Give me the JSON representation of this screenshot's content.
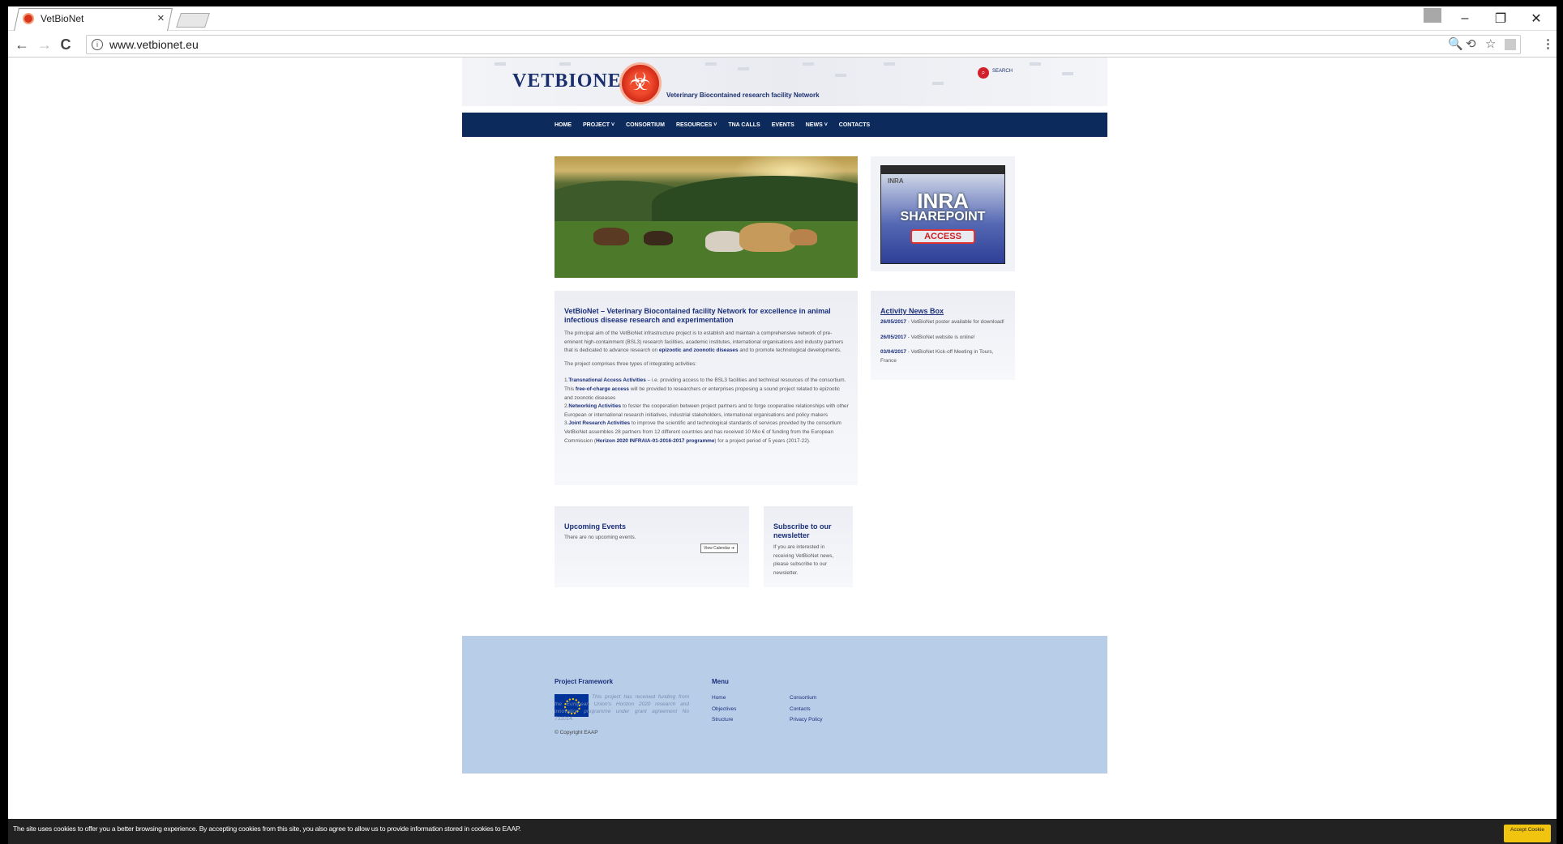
{
  "browser": {
    "tab_title": "VetBioNet",
    "tab_close": "×",
    "url": "www.vetbionet.eu",
    "info_icon": "i",
    "controls": {
      "minimize": "–",
      "restore": "❐",
      "close": "✕"
    },
    "nav": {
      "back": "←",
      "forward": "→",
      "reload": "C"
    },
    "right_icons": {
      "zoom": "🔍",
      "translate": "⟲",
      "bookmark": "☆",
      "menu": "⋮"
    }
  },
  "site": {
    "logo_text": "VETBIONET",
    "tagline": "Veterinary Biocontained research facility Network",
    "search_label": "SEARCH",
    "nav": [
      {
        "label": "HOME"
      },
      {
        "label": "PROJECT ˅"
      },
      {
        "label": "CONSORTIUM"
      },
      {
        "label": "RESOURCES ˅"
      },
      {
        "label": "TNA CALLS"
      },
      {
        "label": "EVENTS"
      },
      {
        "label": "NEWS ˅"
      },
      {
        "label": "CONTACTS"
      }
    ],
    "inra": {
      "logo": "INRA",
      "title": "INRA",
      "subtitle": "SHAREPOINT",
      "button": "ACCESS"
    },
    "intro": {
      "title": "VetBioNet – Veterinary Biocontained facility Network for excellence in animal infectious disease research and experimentation",
      "para1": "The principal aim of the VetBioNet infrastructure project is to establish and maintain a comprehensive network of pre-eminent high-containment (BSL3) research facilities, academic institutes, international organisations and industry partners that is dedicated to advance research on",
      "para1_bold": "epizootic and zoonotic diseases",
      "para1_end": "and to promote technological developments.",
      "para2": "The project comprises three types of integrating activities:",
      "item1_num": "1.",
      "item1_bold": "Transnational Access Activities",
      "item1_text": "– i.e. providing access to the BSL3 facilities and technical resources of the consortium. This",
      "item1_bold2": "free-of-charge access",
      "item1_text2": "will be provided to researchers or enterprises proposing a sound project related to epizootic and zoonotic diseases",
      "item2_num": "2.",
      "item2_bold": "Networking Activities",
      "item2_text": "to foster the cooperation between project partners and to forge cooperative relationships with other European or international research initiatives, industrial stakeholders, international organisations and policy makers",
      "item3_num": "3.",
      "item3_bold": "Joint Research Activities",
      "item3_text": "to improve the scientific and technological standards of services provided by the consortium VetBioNet assembles 28 partners from 12 different countries and has received 10 Mio € of funding from the European Commission (",
      "item3_bold2": "Horizon 2020 INFRAIA-01-2016-2017 programme",
      "item3_text2": ") for a project period of 5 years (2017-22)."
    },
    "news": {
      "title": "Activity News Box",
      "items": [
        {
          "date": "26/05/2017",
          "text": " - VetBioNet poster available for download!"
        },
        {
          "date": "26/05/2017",
          "text": " - VetBioNet website is online!"
        },
        {
          "date": "03/04/2017",
          "text": " - VetBioNet Kick-off Meeting in Tours, France"
        }
      ]
    },
    "events": {
      "title": "Upcoming Events",
      "empty": "There are no upcoming events.",
      "button": "View Calendar ➔"
    },
    "newsletter": {
      "title": "Subscribe to our newsletter",
      "text": "If you are interested in receiving VetBioNet news, please subscribe to our newsletter."
    },
    "footer": {
      "framework_title": "Project Framework",
      "framework_text": "This project has received funding from the European Union's Horizon 2020 research and innovation programme under grant agreement No 731014.",
      "copyright": "© Copyright EAAP",
      "menu_title": "Menu",
      "menu_col1": [
        "Home",
        "Objectives",
        "Structure"
      ],
      "menu_col2": [
        "Consortium",
        "Contacts",
        "Privacy Policy"
      ]
    },
    "cookie": {
      "text": "The site uses cookies to offer you a better browsing experience. By accepting cookies from this site, you also agree to allow us to provide information stored in cookies to EAAP.",
      "button": "Accept Cookie"
    }
  }
}
